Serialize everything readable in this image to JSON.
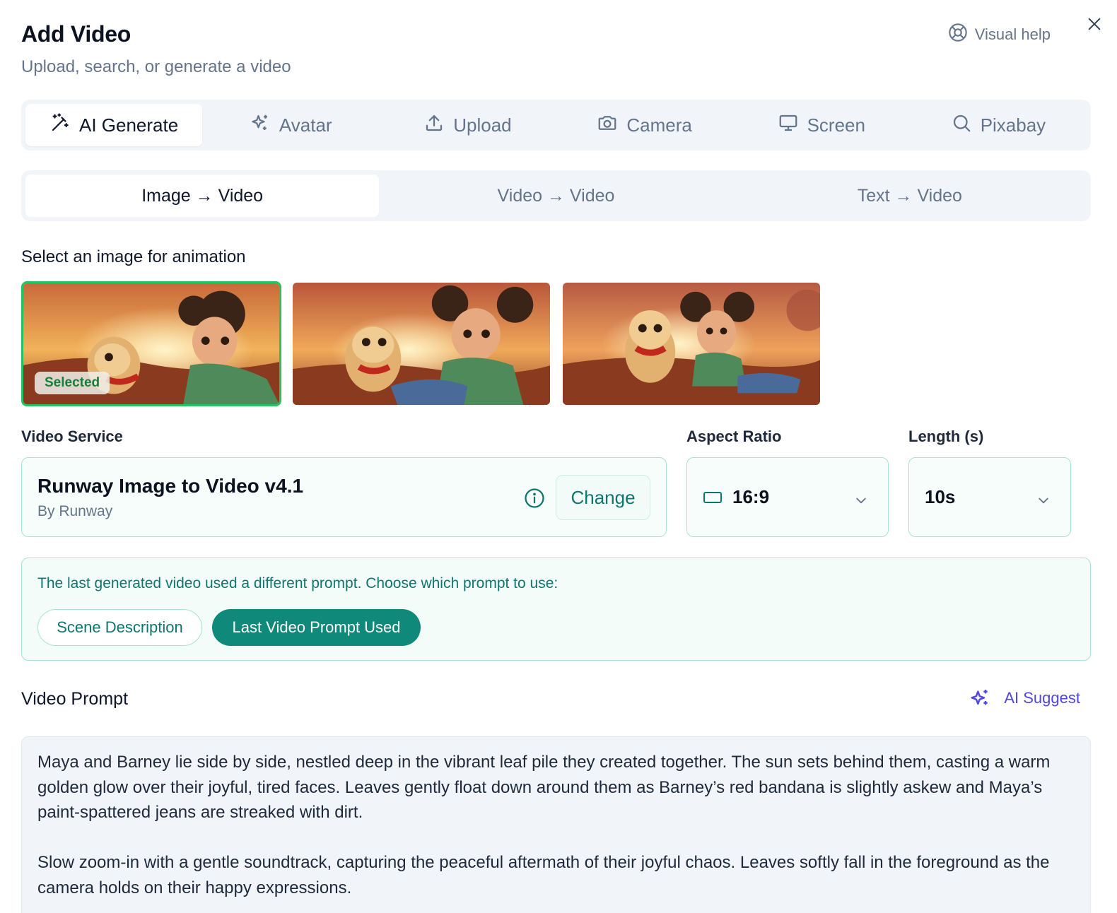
{
  "header": {
    "title": "Add Video",
    "subtitle": "Upload, search, or generate a video",
    "help_label": "Visual help"
  },
  "tabs": [
    {
      "label": "AI Generate",
      "icon": "magic-wand-icon",
      "active": true
    },
    {
      "label": "Avatar",
      "icon": "sparkles-icon",
      "active": false
    },
    {
      "label": "Upload",
      "icon": "upload-icon",
      "active": false
    },
    {
      "label": "Camera",
      "icon": "camera-icon",
      "active": false
    },
    {
      "label": "Screen",
      "icon": "monitor-icon",
      "active": false
    },
    {
      "label": "Pixabay",
      "icon": "search-icon",
      "active": false
    }
  ],
  "subtabs": [
    {
      "label": "Image → Video",
      "active": true
    },
    {
      "label": "Video → Video",
      "active": false
    },
    {
      "label": "Text → Video",
      "active": false
    }
  ],
  "image_select": {
    "label": "Select an image for animation",
    "selected_badge": "Selected"
  },
  "video_service": {
    "label": "Video Service",
    "name": "Runway Image to Video v4.1",
    "by": "By Runway",
    "change_label": "Change"
  },
  "aspect_ratio": {
    "label": "Aspect Ratio",
    "value": "16:9"
  },
  "length": {
    "label": "Length (s)",
    "value": "10s"
  },
  "notice": {
    "text": "The last generated video used a different prompt. Choose which prompt to use:",
    "option_scene": "Scene Description",
    "option_last": "Last Video Prompt Used"
  },
  "prompt": {
    "label": "Video Prompt",
    "suggest_label": "AI Suggest",
    "text": "Maya and Barney lie side by side, nestled deep in the vibrant leaf pile they created together. The sun sets behind them, casting a warm golden glow over their joyful, tired faces. Leaves gently float down around them as Barney’s red bandana is slightly askew and Maya’s paint-spattered jeans are streaked with dirt.\n\nSlow zoom-in with a gentle soundtrack, capturing the peaceful aftermath of their joyful chaos. Leaves softly fall in the foreground as the camera holds on their happy expressions."
  },
  "colors": {
    "accent": "#0f8a7a",
    "selected_border": "#22c55e",
    "suggest": "#4f46e5"
  }
}
